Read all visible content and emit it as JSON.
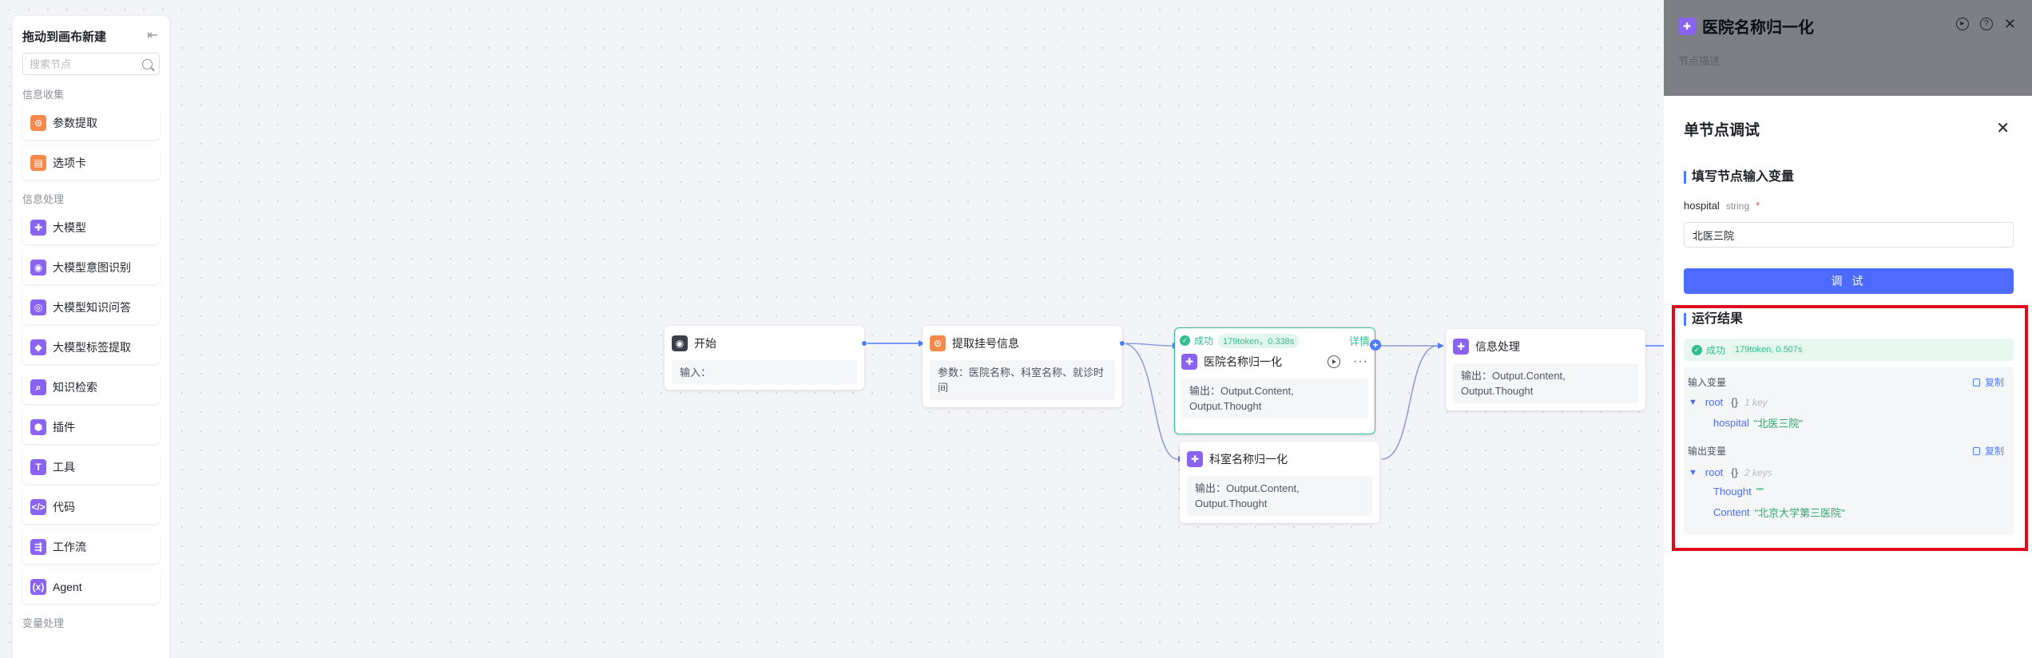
{
  "palette": {
    "title": "拖动到画布新建",
    "search_placeholder": "搜索节点",
    "groups": [
      {
        "label": "信息收集",
        "items": [
          {
            "label": "参数提取",
            "icon": "extract-icon",
            "color": "#f7894a"
          },
          {
            "label": "选项卡",
            "icon": "options-card-icon",
            "color": "#f7894a"
          }
        ]
      },
      {
        "label": "信息处理",
        "items": [
          {
            "label": "大模型",
            "icon": "llm-icon",
            "color": "#8b63f2"
          },
          {
            "label": "大模型意图识别",
            "icon": "intent-icon",
            "color": "#8b63f2"
          },
          {
            "label": "大模型知识问答",
            "icon": "knowledge-qa-icon",
            "color": "#8b63f2"
          },
          {
            "label": "大模型标签提取",
            "icon": "tag-icon",
            "color": "#8b63f2"
          },
          {
            "label": "知识检索",
            "icon": "retrieval-icon",
            "color": "#8b63f2"
          },
          {
            "label": "插件",
            "icon": "plugin-icon",
            "color": "#8b63f2"
          },
          {
            "label": "工具",
            "icon": "tool-icon",
            "color": "#8b63f2"
          },
          {
            "label": "代码",
            "icon": "code-icon",
            "color": "#8b63f2"
          },
          {
            "label": "工作流",
            "icon": "workflow-icon",
            "color": "#8b63f2"
          },
          {
            "label": "Agent",
            "icon": "agent-icon",
            "color": "#8b63f2"
          }
        ]
      },
      {
        "label": "变量处理",
        "items": []
      }
    ]
  },
  "nodes": {
    "start": {
      "title": "开始",
      "body": "输入："
    },
    "extract": {
      "title": "提取挂号信息",
      "body": "参数：医院名称、科室名称、就诊时间"
    },
    "hospital_norm": {
      "title": "医院名称归一化",
      "status": "成功",
      "token_info": "179token，0.338s",
      "detail": "详情",
      "body": "输出：Output.Content, Output.Thought"
    },
    "dept_norm": {
      "title": "科室名称归一化",
      "body": "输出：Output.Content, Output.Thought"
    },
    "info_proc": {
      "title": "信息处理",
      "body": "输出：Output.Content, Output.Thought"
    }
  },
  "side_panel": {
    "title": "医院名称归一化",
    "description": "节点描述"
  },
  "debug": {
    "title": "单节点调试",
    "input_section": "填写节点输入变量",
    "field_name": "hospital",
    "field_type": "string",
    "required_mark": "*",
    "field_value": "北医三院",
    "run_label": "调 试",
    "result_section": "运行结果",
    "result_status": "成功",
    "result_tokens": "179token, 0.507s",
    "input_vars_label": "输入变量",
    "output_vars_label": "输出变量",
    "copy_label": "复制",
    "input_json": {
      "root": "root",
      "brace": "{}",
      "count": "1 key",
      "key": "hospital",
      "value": "\"北医三院\""
    },
    "output_json": {
      "root": "root",
      "brace": "{}",
      "count": "2 keys",
      "key1": "Thought",
      "value1": "\"\"",
      "key2": "Content",
      "value2": "\"北京大学第三医院\""
    }
  },
  "colors": {
    "accent": "#4d6bfe",
    "success": "#2fbe8f",
    "highlight": "#e00b1c"
  }
}
